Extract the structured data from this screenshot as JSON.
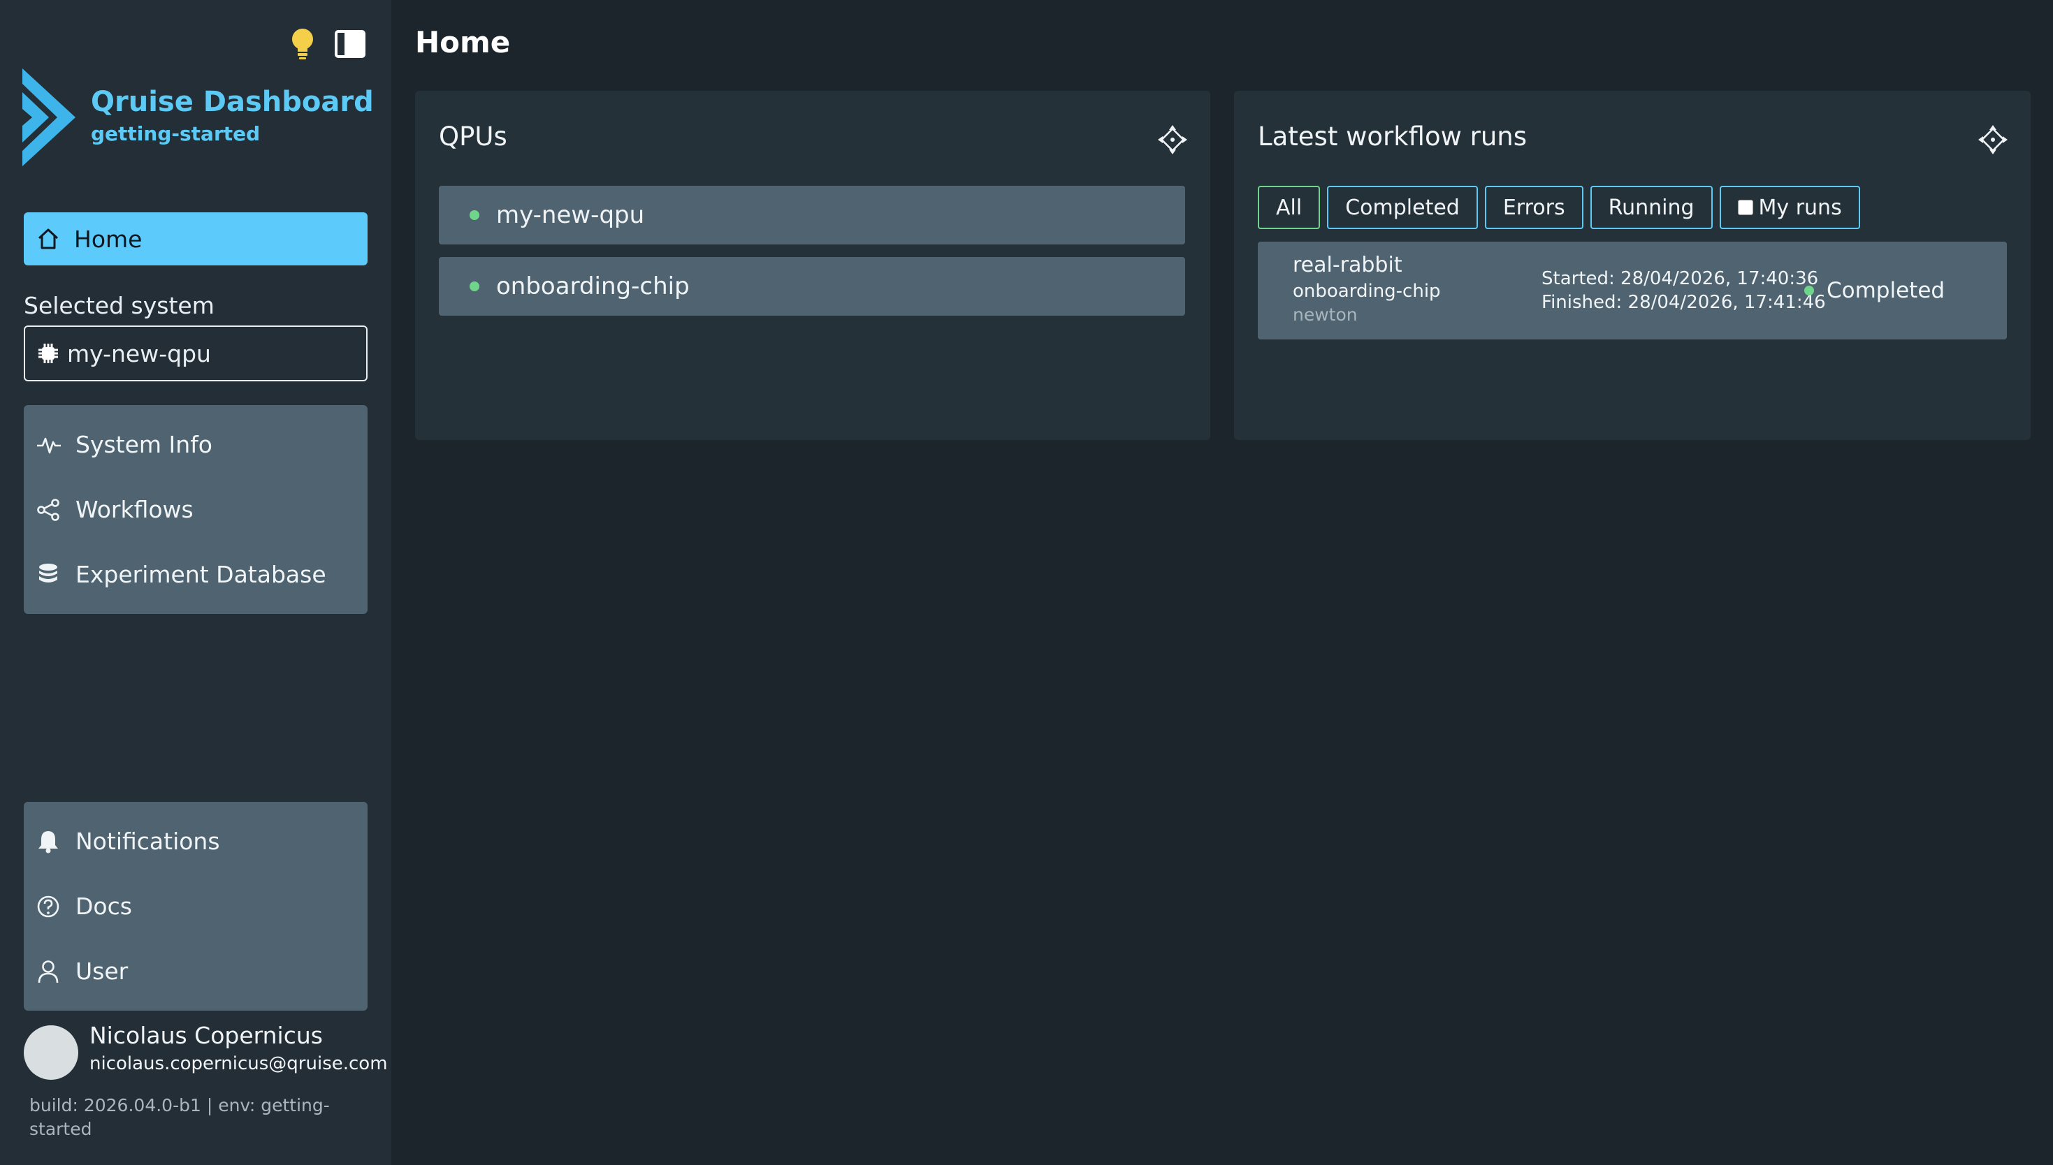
{
  "app": {
    "title": "Qruise Dashboard",
    "environment": "getting-started",
    "accent_color": "#5ccaf5"
  },
  "sidebar": {
    "top_icons": [
      "lightbulb-icon",
      "sidebar-toggle-icon"
    ],
    "home_label": "Home",
    "selected_system_label": "Selected system",
    "selected_system_value": "my-new-qpu",
    "main_nav": [
      {
        "label": "System Info",
        "icon": "activity-icon"
      },
      {
        "label": "Workflows",
        "icon": "workflow-icon"
      },
      {
        "label": "Experiment Database",
        "icon": "database-icon"
      }
    ],
    "bottom_nav": [
      {
        "label": "Notifications",
        "icon": "bell-icon"
      },
      {
        "label": "Docs",
        "icon": "help-icon"
      },
      {
        "label": "User",
        "icon": "user-icon"
      }
    ],
    "user": {
      "name": "Nicolaus Copernicus",
      "email": "nicolaus.copernicus@qruise.com"
    },
    "build_info": "build: 2026.04.0-b1 | env: getting-started"
  },
  "main": {
    "page_title": "Home",
    "qpus_panel": {
      "title": "QPUs",
      "items": [
        {
          "name": "my-new-qpu",
          "status_color": "#6fd58a"
        },
        {
          "name": "onboarding-chip",
          "status_color": "#6fd58a"
        }
      ]
    },
    "runs_panel": {
      "title": "Latest workflow runs",
      "filters": [
        "All",
        "Completed",
        "Errors",
        "Running"
      ],
      "active_filter": "All",
      "my_runs_label": "My runs",
      "my_runs_checked": false,
      "runs": [
        {
          "name": "real-rabbit",
          "chip": "onboarding-chip",
          "user": "newton",
          "started": "Started: 28/04/2026, 17:40:36",
          "finished": "Finished: 28/04/2026, 17:41:46",
          "status": "Completed",
          "status_color": "#6fd58a"
        }
      ]
    }
  }
}
